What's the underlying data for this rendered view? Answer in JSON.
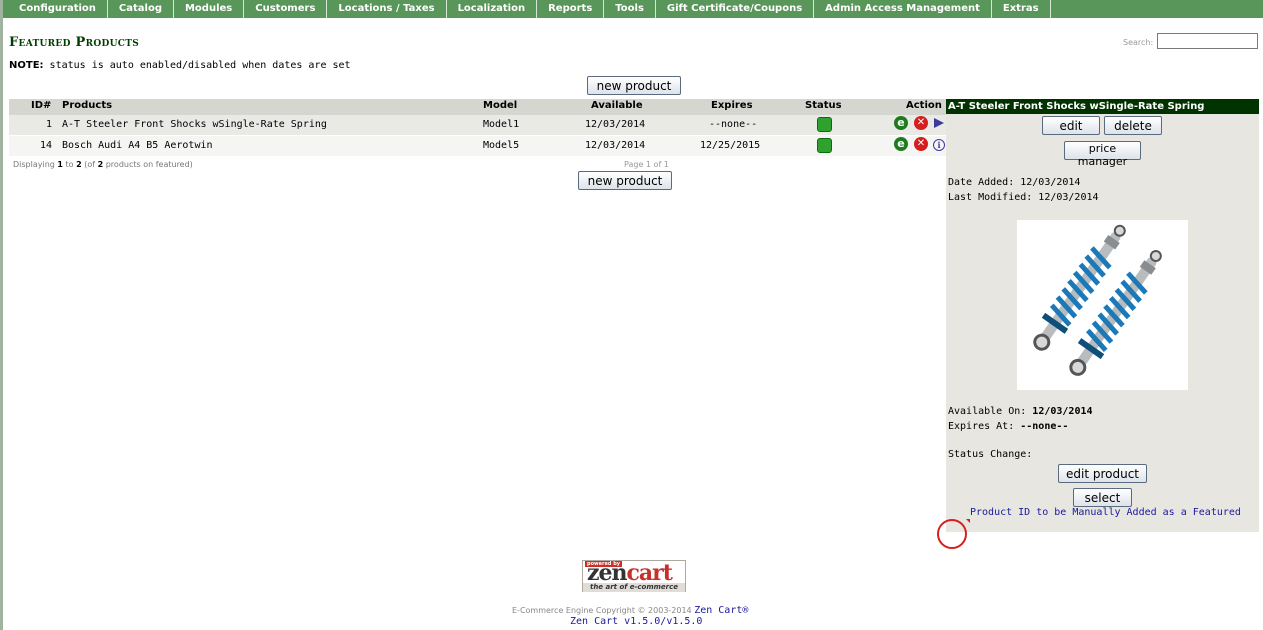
{
  "menu": [
    "Configuration",
    "Catalog",
    "Modules",
    "Customers",
    "Locations / Taxes",
    "Localization",
    "Reports",
    "Tools",
    "Gift Certificate/Coupons",
    "Admin Access Management",
    "Extras"
  ],
  "page": {
    "title": "Featured Products",
    "search_label": "Search:",
    "search_value": "",
    "note_label": "NOTE:",
    "note_text": " status is auto enabled/disabled when dates are set",
    "new_product_label": "new product"
  },
  "table": {
    "headers": {
      "id": "ID#",
      "products": "Products",
      "model": "Model",
      "available": "Available",
      "expires": "Expires",
      "status": "Status",
      "action": "Action"
    },
    "rows": [
      {
        "id": "1",
        "product": "A-T Steeler Front Shocks wSingle-Rate Spring",
        "model": "Model1",
        "available": "12/03/2014",
        "expires": "--none--",
        "status": "enabled"
      },
      {
        "id": "14",
        "product": "Bosch Audi A4 B5 Aerotwin",
        "model": "Model5",
        "available": "12/03/2014",
        "expires": "12/25/2015",
        "status": "enabled"
      }
    ],
    "pager": {
      "prefix": "Displaying ",
      "from": "1",
      "to_word": " to ",
      "to": "2",
      "of_open": " (of ",
      "total": "2",
      "suffix": " products on featured)",
      "page_text": "Page 1 of 1"
    }
  },
  "side_panel": {
    "title": "A-T Steeler Front Shocks wSingle-Rate Spring",
    "edit_label": "edit",
    "delete_label": "delete",
    "price_manager_label": "price manager",
    "date_added": "Date Added: 12/03/2014",
    "last_modified": "Last Modified: 12/03/2014",
    "available_label": "Available On: ",
    "available_value": "12/03/2014",
    "expires_label": "Expires At: ",
    "expires_value": "--none--",
    "status_change": "Status Change:",
    "edit_product_label": "edit product",
    "select_label": "select",
    "manual_link": "Product ID to be Manually Added as a Featured"
  },
  "footer": {
    "logo_powered": "powered by",
    "logo_zen": "zen",
    "logo_cart": "cart",
    "logo_tagline": "the art of e-commerce",
    "copyright": "E-Commerce Engine Copyright © 2003-2014 ",
    "brand_link": "Zen Cart®",
    "version": "Zen Cart v1.5.0/v1.5.0"
  },
  "colors": {
    "menu_bg": "#599659",
    "title": "#003d00",
    "panel_head": "#003300",
    "link": "#1a1a9c"
  }
}
